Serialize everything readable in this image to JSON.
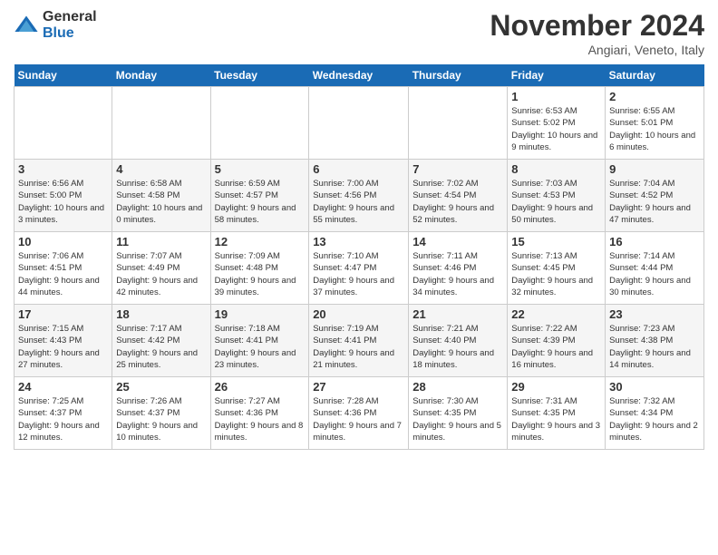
{
  "logo": {
    "general": "General",
    "blue": "Blue"
  },
  "title": "November 2024",
  "subtitle": "Angiari, Veneto, Italy",
  "headers": [
    "Sunday",
    "Monday",
    "Tuesday",
    "Wednesday",
    "Thursday",
    "Friday",
    "Saturday"
  ],
  "weeks": [
    [
      {
        "day": "",
        "info": ""
      },
      {
        "day": "",
        "info": ""
      },
      {
        "day": "",
        "info": ""
      },
      {
        "day": "",
        "info": ""
      },
      {
        "day": "",
        "info": ""
      },
      {
        "day": "1",
        "info": "Sunrise: 6:53 AM\nSunset: 5:02 PM\nDaylight: 10 hours and 9 minutes."
      },
      {
        "day": "2",
        "info": "Sunrise: 6:55 AM\nSunset: 5:01 PM\nDaylight: 10 hours and 6 minutes."
      }
    ],
    [
      {
        "day": "3",
        "info": "Sunrise: 6:56 AM\nSunset: 5:00 PM\nDaylight: 10 hours and 3 minutes."
      },
      {
        "day": "4",
        "info": "Sunrise: 6:58 AM\nSunset: 4:58 PM\nDaylight: 10 hours and 0 minutes."
      },
      {
        "day": "5",
        "info": "Sunrise: 6:59 AM\nSunset: 4:57 PM\nDaylight: 9 hours and 58 minutes."
      },
      {
        "day": "6",
        "info": "Sunrise: 7:00 AM\nSunset: 4:56 PM\nDaylight: 9 hours and 55 minutes."
      },
      {
        "day": "7",
        "info": "Sunrise: 7:02 AM\nSunset: 4:54 PM\nDaylight: 9 hours and 52 minutes."
      },
      {
        "day": "8",
        "info": "Sunrise: 7:03 AM\nSunset: 4:53 PM\nDaylight: 9 hours and 50 minutes."
      },
      {
        "day": "9",
        "info": "Sunrise: 7:04 AM\nSunset: 4:52 PM\nDaylight: 9 hours and 47 minutes."
      }
    ],
    [
      {
        "day": "10",
        "info": "Sunrise: 7:06 AM\nSunset: 4:51 PM\nDaylight: 9 hours and 44 minutes."
      },
      {
        "day": "11",
        "info": "Sunrise: 7:07 AM\nSunset: 4:49 PM\nDaylight: 9 hours and 42 minutes."
      },
      {
        "day": "12",
        "info": "Sunrise: 7:09 AM\nSunset: 4:48 PM\nDaylight: 9 hours and 39 minutes."
      },
      {
        "day": "13",
        "info": "Sunrise: 7:10 AM\nSunset: 4:47 PM\nDaylight: 9 hours and 37 minutes."
      },
      {
        "day": "14",
        "info": "Sunrise: 7:11 AM\nSunset: 4:46 PM\nDaylight: 9 hours and 34 minutes."
      },
      {
        "day": "15",
        "info": "Sunrise: 7:13 AM\nSunset: 4:45 PM\nDaylight: 9 hours and 32 minutes."
      },
      {
        "day": "16",
        "info": "Sunrise: 7:14 AM\nSunset: 4:44 PM\nDaylight: 9 hours and 30 minutes."
      }
    ],
    [
      {
        "day": "17",
        "info": "Sunrise: 7:15 AM\nSunset: 4:43 PM\nDaylight: 9 hours and 27 minutes."
      },
      {
        "day": "18",
        "info": "Sunrise: 7:17 AM\nSunset: 4:42 PM\nDaylight: 9 hours and 25 minutes."
      },
      {
        "day": "19",
        "info": "Sunrise: 7:18 AM\nSunset: 4:41 PM\nDaylight: 9 hours and 23 minutes."
      },
      {
        "day": "20",
        "info": "Sunrise: 7:19 AM\nSunset: 4:41 PM\nDaylight: 9 hours and 21 minutes."
      },
      {
        "day": "21",
        "info": "Sunrise: 7:21 AM\nSunset: 4:40 PM\nDaylight: 9 hours and 18 minutes."
      },
      {
        "day": "22",
        "info": "Sunrise: 7:22 AM\nSunset: 4:39 PM\nDaylight: 9 hours and 16 minutes."
      },
      {
        "day": "23",
        "info": "Sunrise: 7:23 AM\nSunset: 4:38 PM\nDaylight: 9 hours and 14 minutes."
      }
    ],
    [
      {
        "day": "24",
        "info": "Sunrise: 7:25 AM\nSunset: 4:37 PM\nDaylight: 9 hours and 12 minutes."
      },
      {
        "day": "25",
        "info": "Sunrise: 7:26 AM\nSunset: 4:37 PM\nDaylight: 9 hours and 10 minutes."
      },
      {
        "day": "26",
        "info": "Sunrise: 7:27 AM\nSunset: 4:36 PM\nDaylight: 9 hours and 8 minutes."
      },
      {
        "day": "27",
        "info": "Sunrise: 7:28 AM\nSunset: 4:36 PM\nDaylight: 9 hours and 7 minutes."
      },
      {
        "day": "28",
        "info": "Sunrise: 7:30 AM\nSunset: 4:35 PM\nDaylight: 9 hours and 5 minutes."
      },
      {
        "day": "29",
        "info": "Sunrise: 7:31 AM\nSunset: 4:35 PM\nDaylight: 9 hours and 3 minutes."
      },
      {
        "day": "30",
        "info": "Sunrise: 7:32 AM\nSunset: 4:34 PM\nDaylight: 9 hours and 2 minutes."
      }
    ]
  ]
}
